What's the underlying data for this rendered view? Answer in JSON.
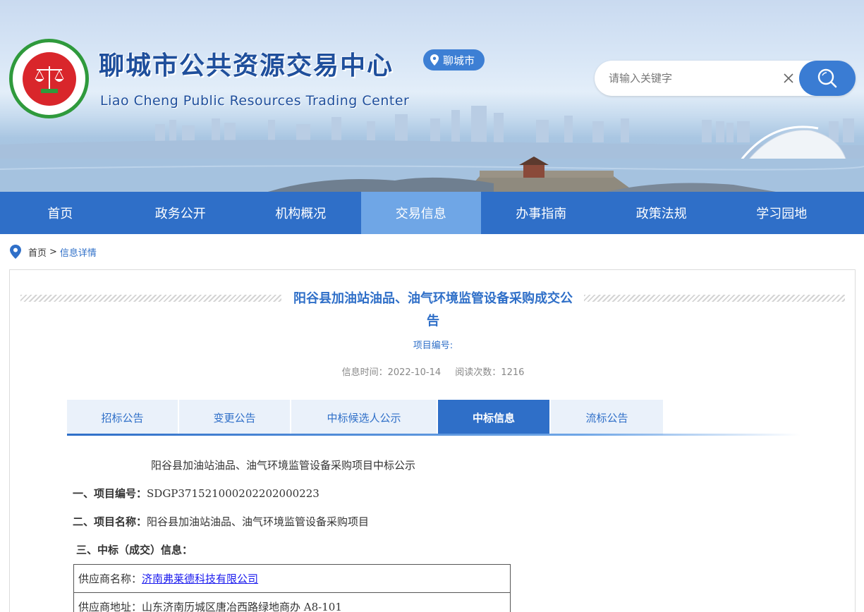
{
  "header": {
    "title": "聊城市公共资源交易中心",
    "subtitle": "Liao Cheng Public Resources Trading Center",
    "city": "聊城市",
    "search_placeholder": "请输入关键字"
  },
  "nav": {
    "items": [
      "首页",
      "政务公开",
      "机构概况",
      "交易信息",
      "办事指南",
      "政策法规",
      "学习园地"
    ],
    "active_index": 3
  },
  "breadcrumb": {
    "home": "首页",
    "separator": ">",
    "current": "信息详情"
  },
  "article": {
    "title_line1": "阳谷县加油站油品、油气环境监管设备采购成交公",
    "title_line2": "告",
    "project_no_label": "项目编号:",
    "info_time": "信息时间：2022-10-14",
    "read_count": "阅读次数：1216"
  },
  "tabs": {
    "items": [
      "招标公告",
      "变更公告",
      "中标候选人公示",
      "中标信息",
      "流标公告"
    ],
    "active_index": 3
  },
  "content": {
    "heading": "阳谷县加油站油品、油气环境监管设备采购项目中标公示",
    "item1_label": "一、项目编号：",
    "item1_value": "SDGP371521000202202000223",
    "item2_label": "二、项目名称：",
    "item2_value": "阳谷县加油站油品、油气环境监管设备采购项目",
    "item3_label": "三、中标（成交）信息：",
    "supplier_name_label": "供应商名称：",
    "supplier_name": "济南弗莱德科技有限公司",
    "supplier_address_label": "供应商地址：",
    "supplier_address": "山东济南历城区唐冶西路绿地商办 A8-101"
  },
  "colors": {
    "brand_blue": "#2f6fc8",
    "nav_active": "#6fa6e6",
    "logo_green": "#2f9a3c",
    "logo_red": "#d9262b"
  }
}
